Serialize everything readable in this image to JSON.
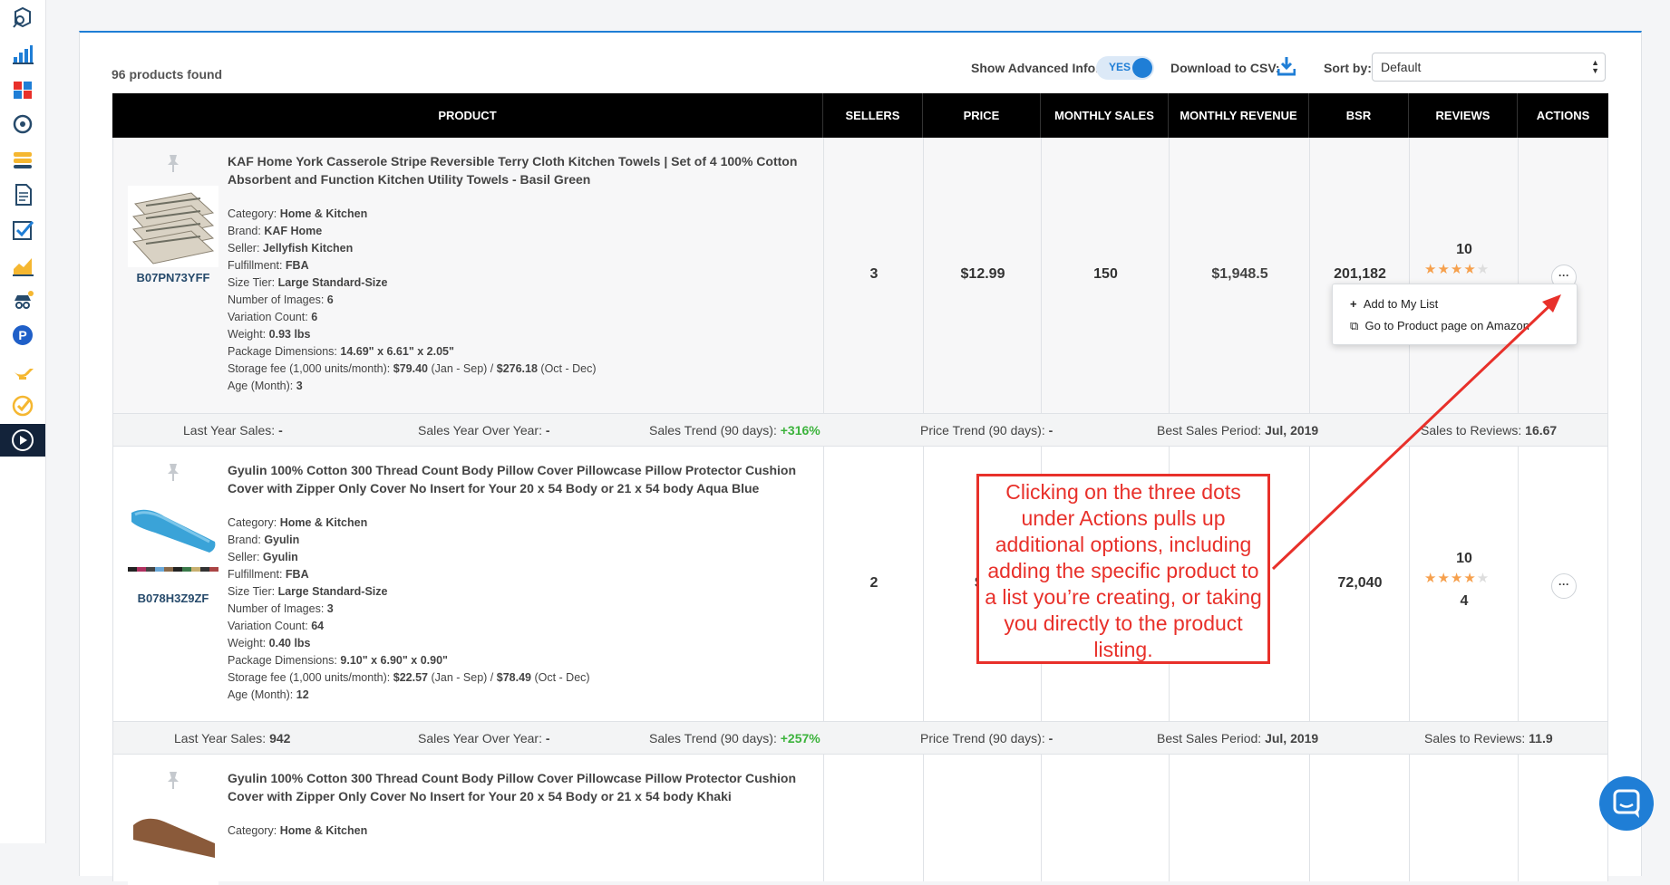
{
  "sidebar": {
    "items": [
      {
        "icon": "cube-search-icon",
        "active": false
      },
      {
        "icon": "bar-chart-icon",
        "active": false
      },
      {
        "icon": "puzzle-icon",
        "active": false
      },
      {
        "icon": "gear-brain-icon",
        "active": false
      },
      {
        "icon": "stack-icon",
        "active": false
      },
      {
        "icon": "document-icon",
        "active": false
      },
      {
        "icon": "checkbox-icon",
        "active": false
      },
      {
        "icon": "area-chart-icon",
        "active": false
      },
      {
        "icon": "spy-icon",
        "active": false
      },
      {
        "icon": "p-badge-icon",
        "active": false
      },
      {
        "icon": "genie-lamp-icon",
        "active": false
      },
      {
        "icon": "check-circle-icon",
        "active": false
      },
      {
        "icon": "play-icon",
        "active": true
      }
    ]
  },
  "toolbar": {
    "products_found": "96 products found",
    "advanced_label": "Show Advanced Info:",
    "advanced_value": "YES",
    "csv_label": "Download to CSV:",
    "sort_label": "Sort by:",
    "sort_value": "Default"
  },
  "table": {
    "headers": [
      "PRODUCT",
      "SELLERS",
      "PRICE",
      "MONTHLY SALES",
      "MONTHLY REVENUE",
      "BSR",
      "REVIEWS",
      "ACTIONS"
    ]
  },
  "products": [
    {
      "asin": "B07PN73YFF",
      "title_line1": "KAF Home York Casserole Stripe Reversible Terry Cloth Kitchen Towels | Set of 4 100% Cotton",
      "title_line2": "Absorbent and Function Kitchen Utility Towels - Basil Green",
      "category": "Home & Kitchen",
      "brand": "KAF Home",
      "seller": "Jellyfish Kitchen",
      "fulfillment": "FBA",
      "size_tier": "Large Standard-Size",
      "num_images": "6",
      "variation_count": "6",
      "weight": "0.93 lbs",
      "package_dimensions": "14.69\" x 6.61\" x 2.05\"",
      "storage_fee_a": "$79.40",
      "storage_fee_b": "$276.18",
      "age": "3",
      "sellers": "3",
      "price": "$12.99",
      "monthly_sales": "150",
      "monthly_revenue": "$1,948.5",
      "bsr": "201,182",
      "reviews_count": "10",
      "rating": 3.5,
      "summary": {
        "last_year_sales": "-",
        "yoy": "-",
        "sales_trend": "+316%",
        "price_trend": "-",
        "best_period": "Jul, 2019",
        "sales_to_reviews": "16.67"
      }
    },
    {
      "asin": "B078H3Z9ZF",
      "title_line1": "Gyulin 100% Cotton 300 Thread Count Body Pillow Cover Pillowcase Pillow Protector Cushion",
      "title_line2": "Cover with Zipper Only Cover No Insert for Your 20 x 54 Body or 21 x 54 body Aqua Blue",
      "category": "Home & Kitchen",
      "brand": "Gyulin",
      "seller": "Gyulin",
      "fulfillment": "FBA",
      "size_tier": "Large Standard-Size",
      "num_images": "3",
      "variation_count": "64",
      "weight": "0.40 lbs",
      "package_dimensions": "9.10\" x 6.90\" x 0.90\"",
      "storage_fee_a": "$22.57",
      "storage_fee_b": "$78.49",
      "age": "12",
      "sellers": "2",
      "price_partial": "$1",
      "bsr": "72,040",
      "reviews_count": "10",
      "rating": 4,
      "rating_text": "4",
      "summary": {
        "last_year_sales": "942",
        "yoy": "-",
        "sales_trend": "+257%",
        "price_trend": "-",
        "best_period": "Jul, 2019",
        "sales_to_reviews": "11.9"
      }
    },
    {
      "title_line1": "Gyulin 100% Cotton 300 Thread Count Body Pillow Cover Pillowcase Pillow Protector Cushion",
      "title_line2": "Cover with Zipper Only Cover No Insert for Your 20 x 54 Body or 21 x 54 body Khaki",
      "category": "Home & Kitchen"
    }
  ],
  "labels": {
    "category": "Category:",
    "brand": "Brand:",
    "seller": "Seller:",
    "fulfillment": "Fulfillment:",
    "size_tier": "Size Tier:",
    "num_images": "Number of Images:",
    "variation_count": "Variation Count:",
    "weight": "Weight:",
    "package_dimensions": "Package Dimensions:",
    "storage_fee": "Storage fee (1,000 units/month):",
    "jan_sep": "(Jan - Sep) /",
    "oct_dec": "(Oct - Dec)",
    "age": "Age (Month):",
    "last_year_sales": "Last Year Sales:",
    "yoy": "Sales Year Over Year:",
    "sales_trend": "Sales Trend (90 days):",
    "price_trend": "Price Trend (90 days):",
    "best_period": "Best Sales Period:",
    "sales_to_reviews": "Sales to Reviews:"
  },
  "action_menu": {
    "add_to_list": "Add to My List",
    "go_to_amazon": "Go to Product page on Amazon"
  },
  "annotation": "Clicking on the three dots under Actions pulls up additional options, including adding the specific product to a list you’re creating, or taking you directly to the product listing.",
  "colors": {
    "accent": "#1f7ed6",
    "sidebar_active": "#13233a",
    "trend_green": "#3cb33c",
    "annotation_red": "#e8302a",
    "star": "#f6a04d"
  }
}
